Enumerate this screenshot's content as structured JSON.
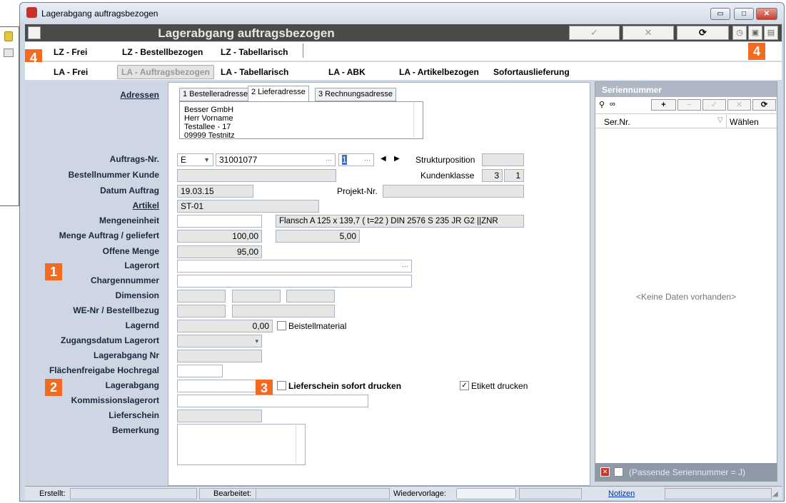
{
  "window": {
    "title": "Lagerabgang auftragsbezogen",
    "min": "▭",
    "max": "□",
    "close": "✕"
  },
  "header": {
    "title": "Lagerabgang auftragsbezogen",
    "buttons": {
      "confirm": "✓",
      "cancel": "✕",
      "refresh": "⟳"
    }
  },
  "badges": {
    "b1": "1",
    "b2": "2",
    "b3": "3",
    "b4": "4"
  },
  "tabs_row1": [
    "LZ - Frei",
    "LZ - Bestellbezogen",
    "LZ - Tabellarisch"
  ],
  "tabs_row2": [
    "LA - Frei",
    "LA - Auftragsbezogen",
    "LA - Tabellarisch",
    "LA - ABK",
    "LA - Artikelbezogen",
    "Sofortauslieferung"
  ],
  "address": {
    "section_label": "Adressen",
    "tabs": [
      "1 Bestelleradresse",
      "2 Lieferadresse",
      "3 Rechnungsadresse"
    ],
    "lines": [
      "Besser GmbH",
      "Herr Vorname",
      "Testallee - 17",
      "09999 Testnitz"
    ]
  },
  "labels": {
    "auftrags_nr": "Auftrags-Nr.",
    "bestellnummer": "Bestellnummer Kunde",
    "datum": "Datum Auftrag",
    "artikel": "Artikel",
    "mengeneinheit": "Mengeneinheit",
    "menge": "Menge Auftrag / geliefert",
    "offene": "Offene Menge",
    "lagerort": "Lagerort",
    "charge": "Chargennummer",
    "dimension": "Dimension",
    "we": "WE-Nr / Bestellbezug",
    "lagernd": "Lagernd",
    "zugang": "Zugangsdatum Lagerort",
    "abgang_nr": "Lagerabgang Nr",
    "flaeche": "Flächenfreigabe Hochregal",
    "lagerabgang": "Lagerabgang",
    "kommission": "Kommissionslagerort",
    "lieferschein": "Lieferschein",
    "bemerkung": "Bemerkung",
    "strukturposition": "Strukturposition",
    "kundenklasse": "Kundenklasse",
    "projekt": "Projekt-Nr."
  },
  "values": {
    "auftrags_typ": "E",
    "auftrags_nr": "31001077",
    "position": "1",
    "kundenklasse_a": "3",
    "kundenklasse_b": "1",
    "datum": "19.03.15",
    "artikel": "ST-01",
    "artikel_text": "Flansch A 125 x 139,7 ( t=22 )   DIN 2576   S 235 JR G2   ||ZNR",
    "menge_auftrag": "100,00",
    "menge_geliefert": "5,00",
    "offene": "95,00",
    "lagernd": "0,00"
  },
  "checks": {
    "beistell": "Beistellmaterial",
    "lieferschein_drucken": "Lieferschein sofort drucken",
    "etikett": "Etikett drucken",
    "etikett_mark": "✓"
  },
  "serial": {
    "title": "Seriennummer",
    "col_sernr": "Ser.Nr.",
    "col_waehlen": "Wählen",
    "empty": "<Keine Daten vorhanden>",
    "footer": "(Passende Seriennummer  = J)",
    "tool": {
      "add": "+",
      "minus": "−",
      "ok": "✓",
      "del": "✕",
      "refresh": "⟳"
    }
  },
  "status": {
    "erstellt": "Erstellt:",
    "bearbeitet": "Bearbeitet:",
    "wiedervorlage": "Wiedervorlage:",
    "notizen": "Notizen"
  }
}
